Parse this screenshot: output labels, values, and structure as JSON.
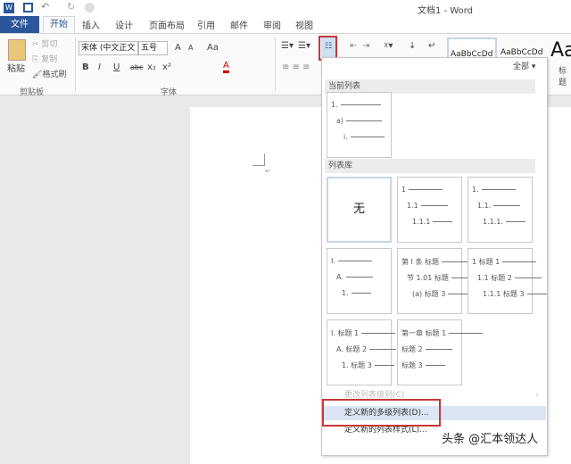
{
  "title": "文档1 - Word",
  "tabs": [
    "文件",
    "开始",
    "插入",
    "设计",
    "页面布局",
    "引用",
    "邮件",
    "审阅",
    "视图"
  ],
  "active_tab": "开始",
  "clipboard": {
    "paste": "粘贴",
    "cut": "剪切",
    "copy": "复制",
    "format_painter": "格式刷",
    "group": "剪贴板"
  },
  "font": {
    "family": "宋体 (中文正文",
    "size": "五号",
    "group": "字体",
    "grow": "A",
    "shrink": "A",
    "case": "Aa",
    "bold": "B",
    "italic": "I",
    "underline": "U",
    "strike": "abc",
    "sub": "x₂",
    "sup": "x²",
    "color_letter": "A"
  },
  "styles": {
    "sample1": "AaBbCcDd",
    "sample2": "AaBbCcDd",
    "sample3": "Aa",
    "heading_label": "标题"
  },
  "accent": "#2b579a",
  "highlight_border": "#c9373a",
  "panel": {
    "filter": "全部",
    "current_header": "当前列表",
    "current_list": [
      "1.",
      "a)",
      "i."
    ],
    "library_header": "列表库",
    "library": [
      {
        "none": "无"
      },
      {
        "lines": [
          "1",
          "1.1",
          "1.1.1"
        ]
      },
      {
        "lines": [
          "1.",
          "1.1.",
          "1.1.1."
        ]
      },
      {
        "lines": [
          "I.",
          "A.",
          "1."
        ]
      },
      {
        "lines": [
          "第 Ⅰ 条 标题",
          "节 1.01 标题",
          "(a) 标题 3"
        ]
      },
      {
        "lines": [
          "1 标题 1",
          "1.1 标题 2",
          "1.1.1 标题 3"
        ]
      },
      {
        "lines": [
          "I. 标题 1",
          "A. 标题 2",
          "1. 标题 3"
        ]
      },
      {
        "lines": [
          "第一章 标题 1",
          "标题 2",
          "标题 3"
        ]
      }
    ],
    "menu": {
      "change_level": "更改列表级别(C)",
      "define_multilevel": "定义新的多级列表(D)...",
      "define_style": "定义新的列表样式(L)..."
    }
  },
  "watermark": "头条 @汇本领达人"
}
